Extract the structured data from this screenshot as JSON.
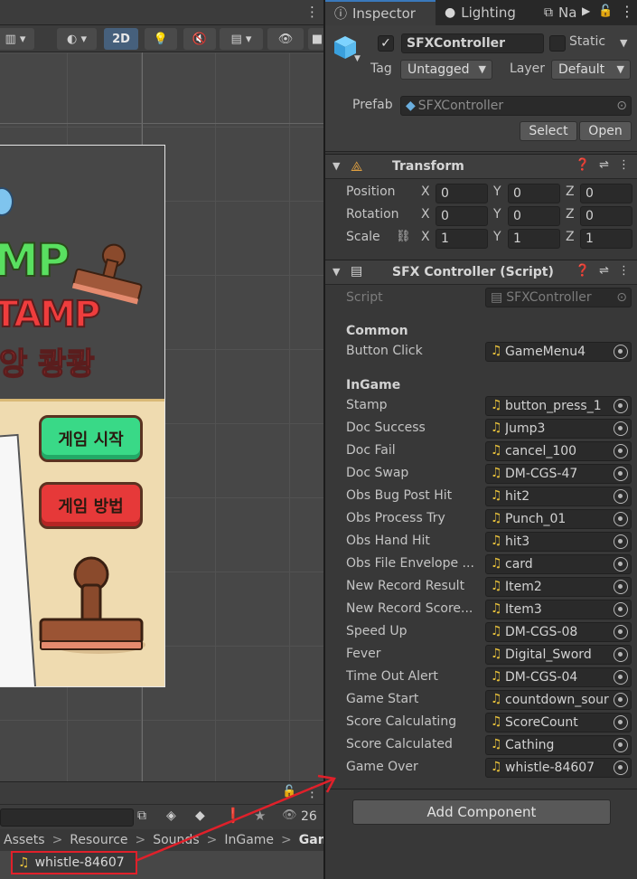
{
  "scene": {
    "toolbar": {
      "mode_2d": "2D"
    },
    "game_title": {
      "line1": "MP",
      "line2": "TAMP",
      "line3": "앙 쾅쾅"
    },
    "buttons": {
      "start": "게임 시작",
      "howto": "게임 방법"
    },
    "bottom": {
      "visible_count": "26"
    },
    "breadcrumb": [
      "Assets",
      "Resource",
      "Sounds",
      "InGame",
      "Game"
    ],
    "selected_file": "whistle-84607"
  },
  "inspector": {
    "tabs": [
      {
        "label": "Inspector",
        "icon": "info-icon"
      },
      {
        "label": "Lighting",
        "icon": "bulb-icon"
      },
      {
        "label": "Na",
        "icon": "navigation-icon"
      }
    ],
    "gameobject": {
      "active": true,
      "name": "SFXController",
      "static_label": "Static",
      "tag_label": "Tag",
      "tag_value": "Untagged",
      "layer_label": "Layer",
      "layer_value": "Default",
      "prefab_label": "Prefab",
      "prefab_value": "SFXController",
      "select_label": "Select",
      "open_label": "Open"
    },
    "transform": {
      "title": "Transform",
      "rows": [
        {
          "label": "Position",
          "x": "0",
          "y": "0",
          "z": "0"
        },
        {
          "label": "Rotation",
          "x": "0",
          "y": "0",
          "z": "0"
        },
        {
          "label": "Scale",
          "x": "1",
          "y": "1",
          "z": "1"
        }
      ],
      "axis": {
        "x": "X",
        "y": "Y",
        "z": "Z"
      }
    },
    "script_component": {
      "title": "SFX Controller (Script)",
      "script_label": "Script",
      "script_value": "SFXController",
      "common_label": "Common",
      "common_rows": [
        {
          "label": "Button Click",
          "value": "GameMenu4"
        }
      ],
      "ingame_label": "InGame",
      "ingame_rows": [
        {
          "label": "Stamp",
          "value": "button_press_1"
        },
        {
          "label": "Doc Success",
          "value": "Jump3"
        },
        {
          "label": "Doc Fail",
          "value": "cancel_100"
        },
        {
          "label": "Doc Swap",
          "value": "DM-CGS-47"
        },
        {
          "label": "Obs Bug Post Hit",
          "value": "hit2"
        },
        {
          "label": "Obs Process Try",
          "value": "Punch_01"
        },
        {
          "label": "Obs Hand Hit",
          "value": "hit3"
        },
        {
          "label": "Obs File Envelope ...",
          "value": "card"
        },
        {
          "label": "New Record Result",
          "value": "Item2"
        },
        {
          "label": "New Record Score...",
          "value": "Item3"
        },
        {
          "label": "Speed Up",
          "value": "DM-CGS-08"
        },
        {
          "label": "Fever",
          "value": "Digital_Sword"
        },
        {
          "label": "Time Out Alert",
          "value": "DM-CGS-04"
        },
        {
          "label": "Game Start",
          "value": "countdown_sour"
        },
        {
          "label": "Score Calculating",
          "value": "ScoreCount"
        },
        {
          "label": "Score Calculated",
          "value": "Cathing"
        },
        {
          "label": "Game Over",
          "value": "whistle-84607"
        }
      ]
    },
    "add_component_label": "Add Component"
  },
  "colors": {
    "accent": "#46607c",
    "highlight_box": "#e0202a",
    "audio_icon": "#e6c03c"
  }
}
